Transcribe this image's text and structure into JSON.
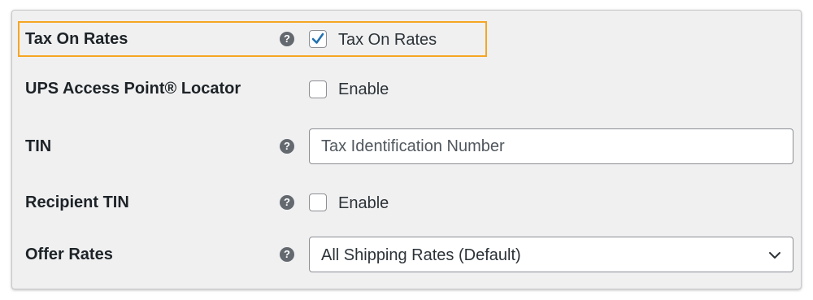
{
  "settings": {
    "tax_on_rates": {
      "label": "Tax On Rates",
      "checkbox_label": "Tax On Rates",
      "checked": true
    },
    "ups_access_point": {
      "label": "UPS Access Point® Locator",
      "checkbox_label": "Enable",
      "checked": false
    },
    "tin": {
      "label": "TIN",
      "placeholder": "Tax Identification Number",
      "value": ""
    },
    "recipient_tin": {
      "label": "Recipient TIN",
      "checkbox_label": "Enable",
      "checked": false
    },
    "offer_rates": {
      "label": "Offer Rates",
      "selected": "All Shipping Rates (Default)"
    }
  },
  "icons": {
    "help": "question-mark-circle-icon",
    "check": "checkmark-icon",
    "chevron": "chevron-down-icon"
  },
  "colors": {
    "highlight": "#f5a623",
    "checkmark": "#2271b1",
    "help_icon": "#646970",
    "panel_bg": "#f0f0f1"
  }
}
